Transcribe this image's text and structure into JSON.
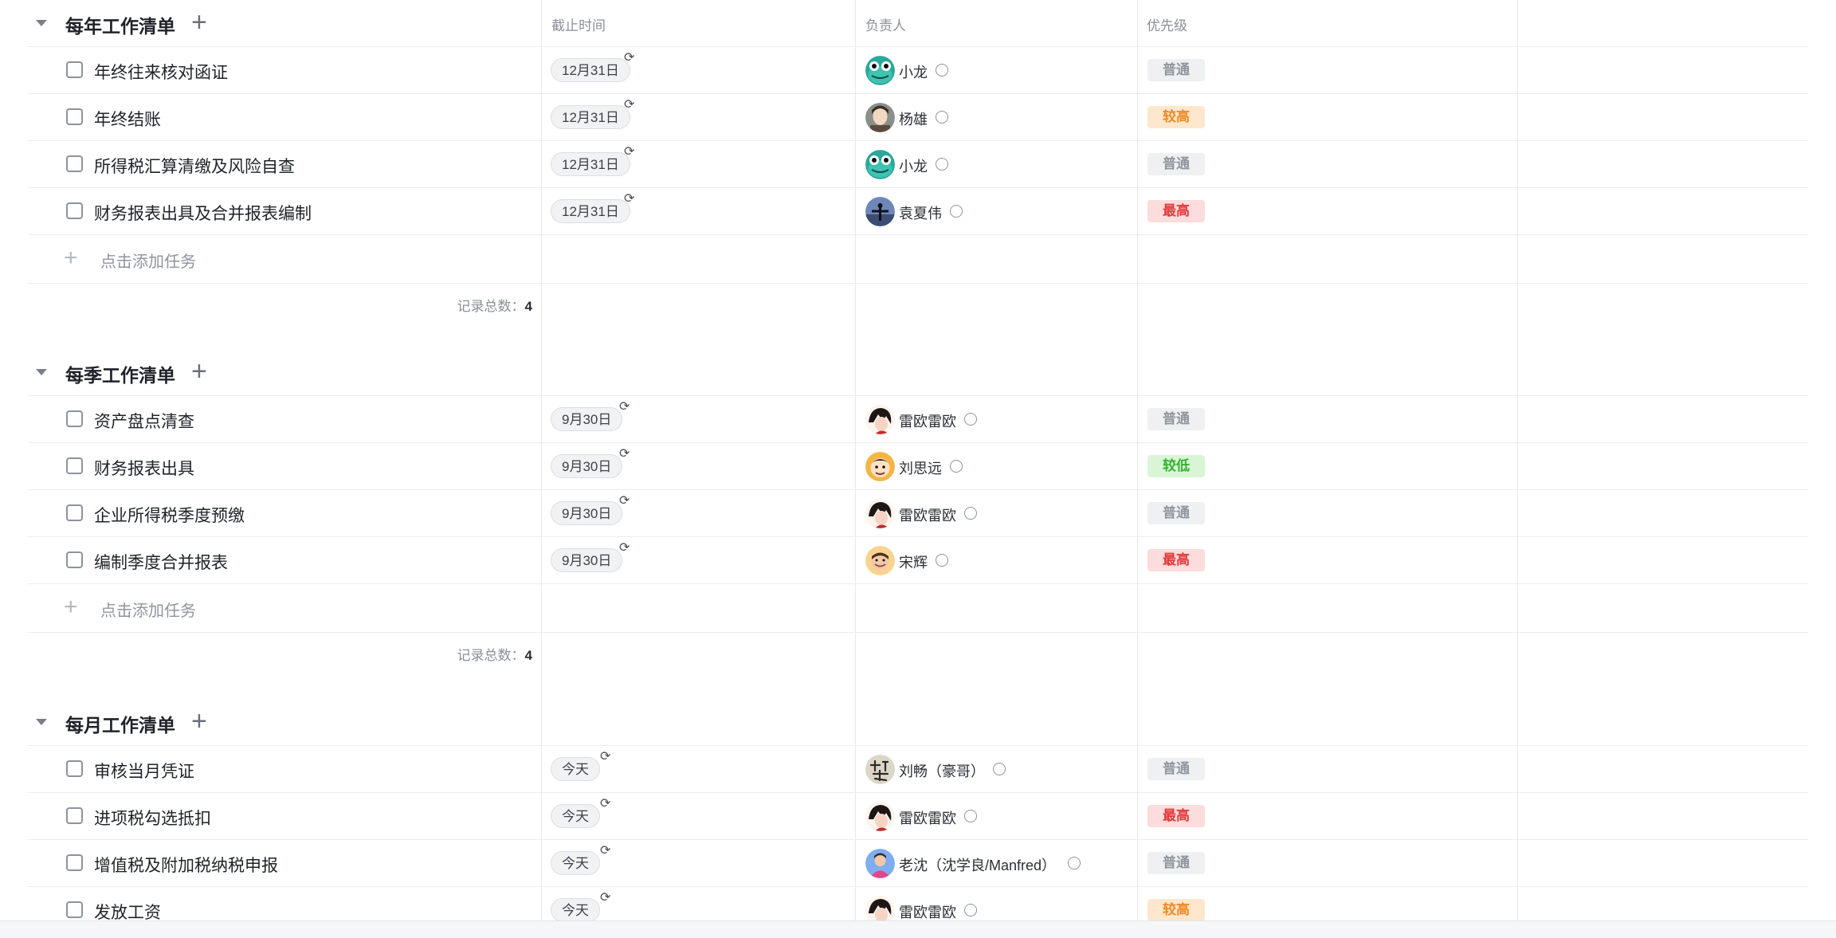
{
  "columns": {
    "deadline": "截止时间",
    "assignee": "负责人",
    "priority": "优先级"
  },
  "add_task_label": "点击添加任务",
  "count_label": "记录总数：",
  "priority_colors": {
    "普通": {
      "bg": "#eff0f1",
      "fg": "#8f959e"
    },
    "较高": {
      "bg": "#fee7cd",
      "fg": "#f08a24"
    },
    "最高": {
      "bg": "#fcdcdc",
      "fg": "#e13a3a"
    },
    "较低": {
      "bg": "#d9f5d6",
      "fg": "#34b233"
    }
  },
  "groups": [
    {
      "title": "每年工作清单",
      "count": "4",
      "tasks": [
        {
          "title": "年终往来核对函证",
          "date": "12月31日",
          "assignee": "小龙",
          "avatar": "frog-avatar",
          "priority": "普通"
        },
        {
          "title": "年终结账",
          "date": "12月31日",
          "assignee": "杨雄",
          "avatar": "portrait-avatar",
          "priority": "较高"
        },
        {
          "title": "所得税汇算清缴及风险自查",
          "date": "12月31日",
          "assignee": "小龙",
          "avatar": "frog-avatar",
          "priority": "普通"
        },
        {
          "title": "财务报表出具及合并报表编制",
          "date": "12月31日",
          "assignee": "袁夏伟",
          "avatar": "sky-avatar",
          "priority": "最高"
        }
      ]
    },
    {
      "title": "每季工作清单",
      "count": "4",
      "tasks": [
        {
          "title": "资产盘点清查",
          "date": "9月30日",
          "assignee": "雷欧雷欧",
          "avatar": "anime-avatar",
          "priority": "普通"
        },
        {
          "title": "财务报表出具",
          "date": "9月30日",
          "assignee": "刘思远",
          "avatar": "cartoon-avatar",
          "priority": "较低"
        },
        {
          "title": "企业所得税季度预缴",
          "date": "9月30日",
          "assignee": "雷欧雷欧",
          "avatar": "anime-avatar",
          "priority": "普通"
        },
        {
          "title": "编制季度合并报表",
          "date": "9月30日",
          "assignee": "宋辉",
          "avatar": "smile-avatar",
          "priority": "最高"
        }
      ]
    },
    {
      "title": "每月工作清单",
      "count": null,
      "tasks": [
        {
          "title": "审核当月凭证",
          "date": "今天",
          "assignee": "刘畅（豪哥）",
          "avatar": "calligraphy-avatar",
          "priority": "普通"
        },
        {
          "title": "进项税勾选抵扣",
          "date": "今天",
          "assignee": "雷欧雷欧",
          "avatar": "anime-avatar",
          "priority": "最高"
        },
        {
          "title": "增值税及附加税纳税申报",
          "date": "今天",
          "assignee": "老沈（沈学良/Manfred）",
          "avatar": "blue-avatar",
          "priority": "普通"
        },
        {
          "title": "发放工资",
          "date": "今天",
          "assignee": "雷欧雷欧",
          "avatar": "anime-avatar",
          "priority": "较高"
        }
      ]
    }
  ]
}
